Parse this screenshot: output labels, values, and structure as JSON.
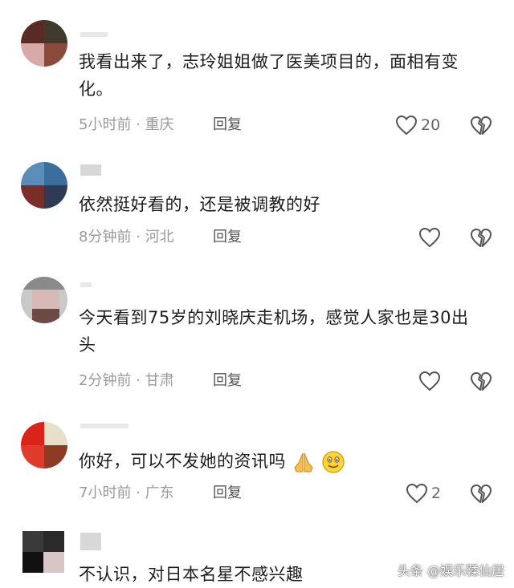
{
  "comments": [
    {
      "text": "我看出来了，志玲姐姐做了医美项目的，面相有变化。",
      "time": "5小时前",
      "location": "重庆",
      "reply_label": "回复",
      "likes": "20"
    },
    {
      "text": "依然挺好看的，还是被调教的好",
      "time": "8分钟前",
      "location": "河北",
      "reply_label": "回复",
      "likes": ""
    },
    {
      "text": "今天看到75岁的刘晓庆走机场，感觉人家也是30出头",
      "time": "2分钟前",
      "location": "甘肃",
      "reply_label": "回复",
      "likes": ""
    },
    {
      "text": "你好，可以不发她的资讯吗",
      "time": "7小时前",
      "location": "广东",
      "reply_label": "回复",
      "likes": "2"
    },
    {
      "text": "不认识，对日本名星不感兴趣",
      "time": "",
      "location": "",
      "reply_label": "",
      "likes": ""
    }
  ],
  "meta_separator": "·",
  "watermark": "头条 @娱乐鞣仙居",
  "icons": {
    "like": "heart-outline-icon",
    "dislike": "broken-heart-icon",
    "emoji_1": "praying-hands-icon",
    "emoji_2": "smiling-face-icon"
  }
}
